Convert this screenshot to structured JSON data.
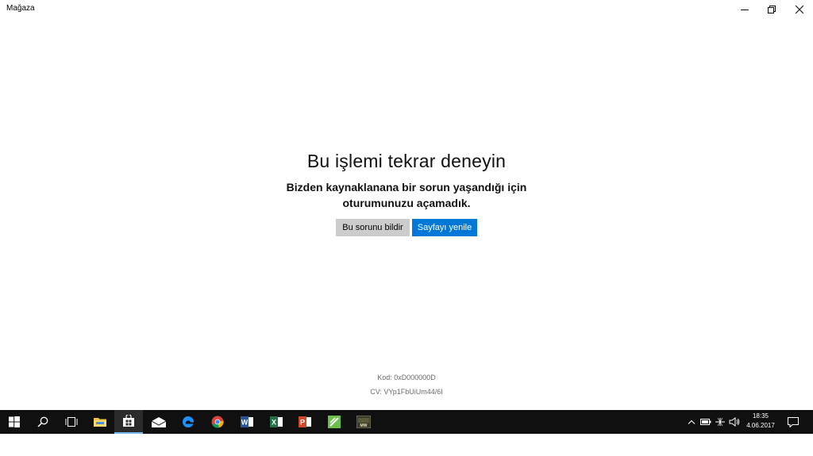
{
  "window": {
    "title": "Mağaza",
    "controls": {
      "minimize": "minimize-icon",
      "restore": "restore-icon",
      "close": "close-icon"
    }
  },
  "error": {
    "title": "Bu işlemi tekrar deneyin",
    "message_line1": "Bizden kaynaklanana bir sorun yaşandığı için",
    "message_line2": "oturumunuzu açamadık.",
    "report_button": "Bu sorunu bildir",
    "refresh_button": "Sayfayı yenile",
    "code": "Kod: 0xD000000D",
    "cv": "CV: VYp1FbUiUm44/6I"
  },
  "taskbar": {
    "items": [
      {
        "name": "start-button",
        "icon": "windows-logo-icon"
      },
      {
        "name": "search-button",
        "icon": "search-icon"
      },
      {
        "name": "task-view-button",
        "icon": "task-view-icon"
      },
      {
        "name": "file-explorer",
        "icon": "folder-icon"
      },
      {
        "name": "store-app",
        "icon": "store-bag-icon",
        "active": true
      },
      {
        "name": "mail-app",
        "icon": "mail-icon"
      },
      {
        "name": "edge-browser",
        "icon": "edge-icon"
      },
      {
        "name": "chrome-browser",
        "icon": "chrome-icon"
      },
      {
        "name": "word-app",
        "icon": "word-icon"
      },
      {
        "name": "excel-app",
        "icon": "excel-icon"
      },
      {
        "name": "powerpoint-app",
        "icon": "powerpoint-icon"
      },
      {
        "name": "feedly-app",
        "icon": "green-app-icon"
      },
      {
        "name": "minecraft-app",
        "icon": "game-icon"
      }
    ],
    "tray": {
      "icons": [
        "chevron-up-icon",
        "battery-icon",
        "network-icon",
        "volume-icon"
      ],
      "time": "18:35",
      "date": "4.06.2017",
      "notification": "action-center-icon"
    },
    "colors": {
      "background": "#101010",
      "accent": "#0078d7",
      "active_underline": "#76b9ed"
    }
  }
}
